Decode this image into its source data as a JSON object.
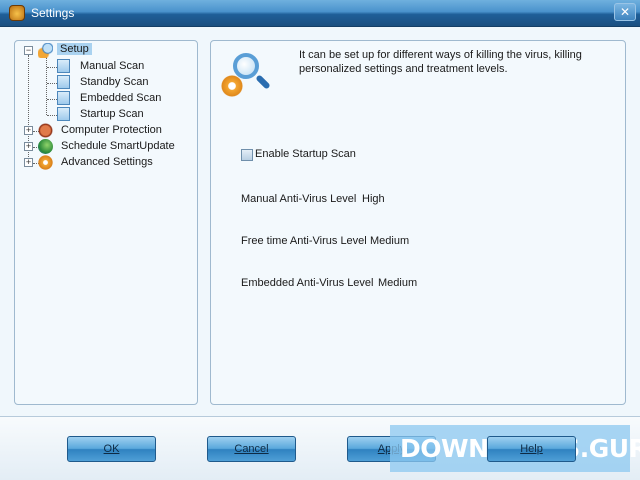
{
  "window": {
    "title": "Settings",
    "close": "✕"
  },
  "tree": {
    "root": {
      "label": "Setup",
      "children": [
        "Manual Scan",
        "Standby Scan",
        "Embedded Scan",
        "Startup Scan"
      ]
    },
    "items": [
      "Computer Protection",
      "Schedule SmartUpdate",
      "Advanced Settings"
    ]
  },
  "content": {
    "description": "It can be set up for different ways of killing the virus, killing personalized settings and treatment levels.",
    "enable_startup_scan": {
      "label": "Enable Startup Scan",
      "checked": false
    },
    "manual_level": {
      "label": "Manual Anti-Virus Level",
      "value": "High"
    },
    "freetime_level": {
      "label": "Free time Anti-Virus Level",
      "value": "Medium"
    },
    "embedded_level": {
      "label": "Embedded Anti-Virus Level",
      "value": "Medium"
    }
  },
  "buttons": {
    "ok": "OK",
    "cancel": "Cancel",
    "apply": "Apply",
    "help": "Help"
  },
  "watermark": "DOWNLOADS.GURU"
}
